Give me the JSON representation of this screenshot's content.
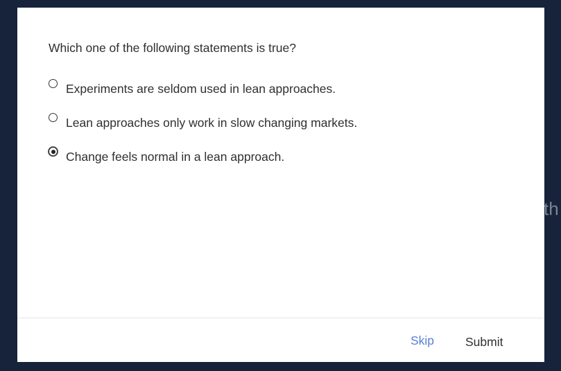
{
  "background": {
    "peek_text": "th"
  },
  "quiz": {
    "question": "Which one of the following statements is true?",
    "options": [
      {
        "label": "Experiments are seldom used in lean approaches.",
        "selected": false
      },
      {
        "label": "Lean approaches only work in slow changing markets.",
        "selected": false
      },
      {
        "label": "Change feels normal in a lean approach.",
        "selected": true
      }
    ]
  },
  "footer": {
    "skip_label": "Skip",
    "submit_label": "Submit"
  },
  "colors": {
    "backdrop": "#17233a",
    "link": "#5a7fd6",
    "text": "#2d2f31"
  }
}
